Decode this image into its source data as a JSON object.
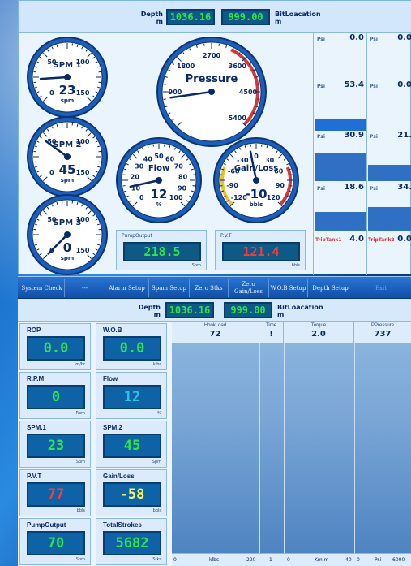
{
  "colors": {
    "lcd_green": "#34e24a",
    "lcd_red": "#ff3b30",
    "lcd_yellow": "#f4f46a",
    "panel_bg": "#eaf4fd",
    "toolbar_bg": "#1a5fbf",
    "gauge_red_zone": "#d23a3a"
  },
  "top": {
    "depth_label": "Depth",
    "depth_unit": "m",
    "depth_value": "1036.16",
    "bitloc_value": "999.00",
    "bitloc_label": "BitLoacation",
    "bitloc_unit": "m",
    "gauges": {
      "spm1": {
        "title": "SPM 1",
        "value": "23",
        "unit": "spm",
        "ticks": [
          "0",
          "50",
          "100",
          "150"
        ],
        "reading": 23
      },
      "spm2": {
        "title": "SPM 2",
        "value": "45",
        "unit": "spm",
        "ticks": [
          "0",
          "50",
          "100",
          "150"
        ],
        "reading": 45
      },
      "spm3": {
        "title": "SPM 3",
        "value": "0",
        "unit": "spm",
        "ticks": [
          "0",
          "50",
          "100",
          "150"
        ],
        "reading": 0
      },
      "pressure": {
        "title": "Pressure",
        "ticks": [
          "900",
          "1800",
          "2700",
          "3600",
          "4500",
          "5400"
        ],
        "value": "",
        "reading": 737
      },
      "flow": {
        "title": "Flow",
        "value": "12",
        "unit": "%",
        "ticks": [
          "0",
          "10",
          "20",
          "30",
          "40",
          "50",
          "60",
          "70",
          "80",
          "90",
          "100"
        ],
        "reading": 12
      },
      "gainloss": {
        "title": "Gain/Loss",
        "value": "-10",
        "unit": "bbls",
        "ticks": [
          "-120",
          "-90",
          "-60",
          "-30",
          "0",
          "30",
          "60",
          "90",
          "120"
        ],
        "reading": -10
      }
    },
    "pump_output": {
      "label": "PumpOutput",
      "value": "218.5",
      "unit": "Spm"
    },
    "pvt": {
      "label": "P.V.T",
      "value": "121.4",
      "unit": "bbls"
    },
    "tanks": [
      {
        "prefix": "Psi",
        "value": "0.0"
      },
      {
        "prefix": "Psi",
        "value": "0.0"
      },
      {
        "prefix": "Psi",
        "value": "53.4"
      },
      {
        "prefix": "Psi",
        "value": "0.0"
      },
      {
        "prefix": "Psi",
        "value": "30.9"
      },
      {
        "prefix": "Psi",
        "value": "21."
      },
      {
        "prefix": "Psi",
        "value": "18.6"
      },
      {
        "prefix": "Psi",
        "value": "34."
      }
    ],
    "trip_tank1": {
      "label": "TripTank1",
      "value": "4.0"
    },
    "trip_tank2": {
      "label": "TripTank2",
      "value": "0.0"
    }
  },
  "toolbar": {
    "buttons": [
      "System Check",
      "---",
      "Alarm Setup",
      "Spam Setup",
      "Zero Stks",
      "Zero Gain/Loss",
      "W.O.B Setup",
      "Depth Setup",
      "Exit"
    ]
  },
  "bottom": {
    "depth_label": "Depth",
    "depth_unit": "m",
    "depth_value": "1036.16",
    "bitloc_value": "999.00",
    "bitloc_label": "BitLoacation",
    "bitloc_unit": "m",
    "tiles": [
      {
        "label": "ROP",
        "value": "0.0",
        "unit": "m/hr",
        "color": "#34e24a"
      },
      {
        "label": "W.O.B",
        "value": "0.0",
        "unit": "klbs",
        "color": "#34e24a"
      },
      {
        "label": "R.P.M",
        "value": "0",
        "unit": "Rpm",
        "color": "#34e24a"
      },
      {
        "label": "Flow",
        "value": "12",
        "unit": "%",
        "color": "#2fc2e8"
      },
      {
        "label": "SPM.1",
        "value": "23",
        "unit": "Spm",
        "color": "#34e24a"
      },
      {
        "label": "SPM.2",
        "value": "45",
        "unit": "Spm",
        "color": "#34e24a"
      },
      {
        "label": "P.V.T",
        "value": "77",
        "unit": "bbls",
        "color": "#ff3b30"
      },
      {
        "label": "Gain/Loss",
        "value": "-58",
        "unit": "bbls",
        "color": "#f4f46a"
      },
      {
        "label": "PumpOutput",
        "value": "70",
        "unit": "Spm",
        "color": "#34e24a"
      },
      {
        "label": "TotalStrokes",
        "value": "5682",
        "unit": "Stks",
        "color": "#34e24a"
      }
    ],
    "columns": [
      {
        "name": "HookLoad",
        "value": "72"
      },
      {
        "name": "Time",
        "value": "!"
      },
      {
        "name": "Torque",
        "value": "2.0"
      },
      {
        "name": "PPressure",
        "value": "737"
      }
    ],
    "axis_foot": {
      "hook_min": "0",
      "hook_unit": "klbs",
      "hook_max": "220",
      "time": "1",
      "torque_min": "0",
      "torque_unit": "Km.m",
      "torque_max": "40",
      "press_min": "0",
      "press_unit": "Psi",
      "press_max": "6000"
    }
  }
}
